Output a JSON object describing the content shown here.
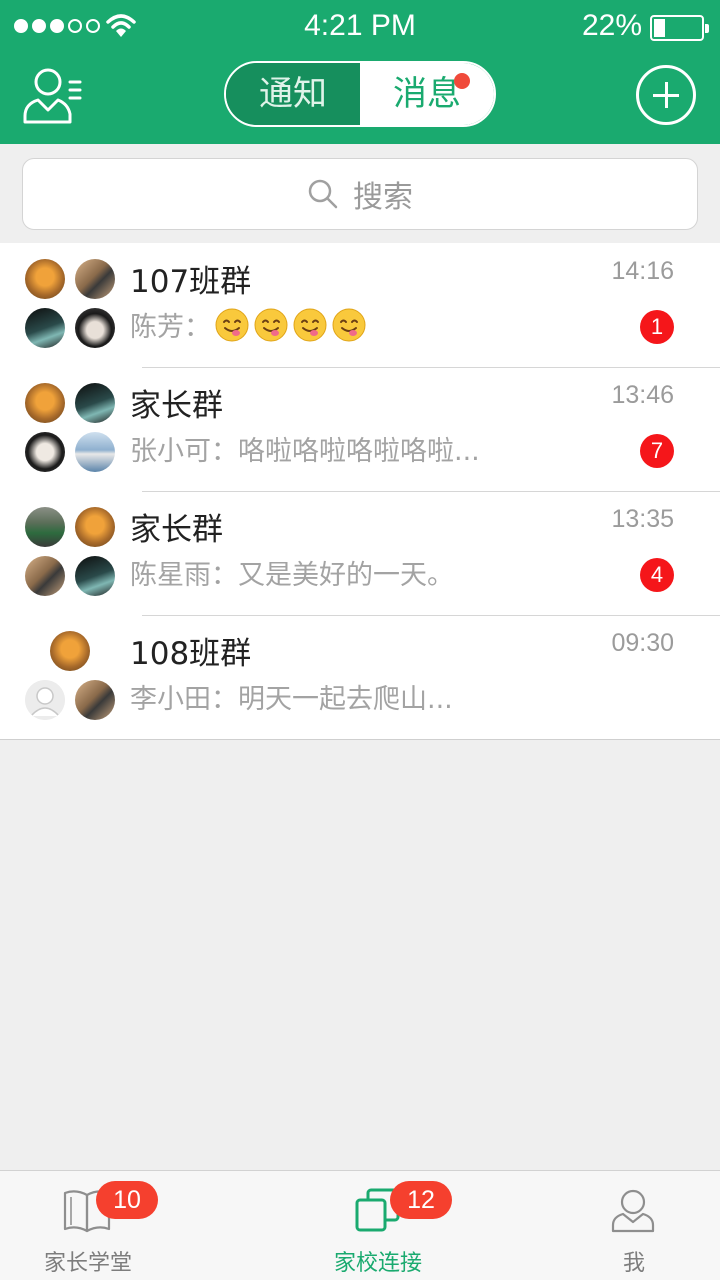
{
  "status_bar": {
    "time": "4:21 PM",
    "battery": "22%",
    "signal_bars_filled": 3,
    "signal_bars_total": 5,
    "battery_level": 0.22
  },
  "header": {
    "tabs": [
      {
        "label": "通知",
        "active": false
      },
      {
        "label": "消息",
        "active": true,
        "has_badge": true
      }
    ],
    "left_icon": "contacts-icon",
    "right_icon": "add-circle-icon"
  },
  "search": {
    "placeholder": "搜索"
  },
  "conversations": [
    {
      "name": "107班群",
      "time": "14:16",
      "sender": "陈芳：",
      "message": "",
      "emoji_count": 4,
      "unread": "1"
    },
    {
      "name": "家长群",
      "time": "13:46",
      "sender": "张小可：",
      "message": "咯啦咯啦咯啦咯啦...",
      "unread": "7"
    },
    {
      "name": "家长群",
      "time": "13:35",
      "sender": "陈星雨：",
      "message": "又是美好的一天。",
      "unread": "4"
    },
    {
      "name": "108班群",
      "time": "09:30",
      "sender": "李小田：",
      "message": "明天一起去爬山..."
    }
  ],
  "tabbar": [
    {
      "label": "家长学堂",
      "badge": "10",
      "icon": "book-icon",
      "active": false
    },
    {
      "label": "家校连接",
      "badge": "12",
      "icon": "devices-icon",
      "active": true
    },
    {
      "label": "我",
      "icon": "person-icon",
      "active": false
    }
  ],
  "colors": {
    "brand": "#1aaa6f",
    "badge": "#f5161a",
    "tab_badge": "#f5402e"
  }
}
